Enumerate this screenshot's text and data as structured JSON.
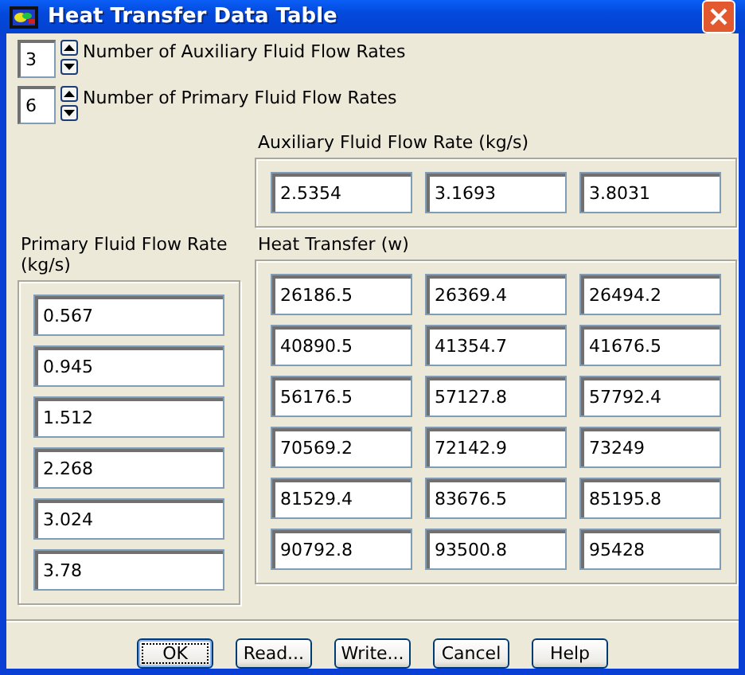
{
  "window": {
    "title": "Heat Transfer Data Table"
  },
  "counts": [
    {
      "value": "3",
      "label": "Number of Auxiliary Fluid Flow Rates"
    },
    {
      "value": "6",
      "label": "Number of Primary Fluid Flow Rates"
    }
  ],
  "auxiliary": {
    "label": "Auxiliary Fluid Flow Rate (kg/s)",
    "values": [
      "2.5354",
      "3.1693",
      "3.8031"
    ]
  },
  "primary": {
    "label": "Primary Fluid Flow Rate (kg/s)",
    "values": [
      "0.567",
      "0.945",
      "1.512",
      "2.268",
      "3.024",
      "3.78"
    ]
  },
  "heat_transfer": {
    "label": "Heat Transfer (w)",
    "rows": [
      [
        "26186.5",
        "26369.4",
        "26494.2"
      ],
      [
        "40890.5",
        "41354.7",
        "41676.5"
      ],
      [
        "56176.5",
        "57127.8",
        "57792.4"
      ],
      [
        "70569.2",
        "72142.9",
        "73249"
      ],
      [
        "81529.4",
        "83676.5",
        "85195.8"
      ],
      [
        "90792.8",
        "93500.8",
        "95428"
      ]
    ]
  },
  "buttons": [
    {
      "label": "OK",
      "focused": true
    },
    {
      "label": "Read...",
      "focused": false
    },
    {
      "label": "Write...",
      "focused": false
    },
    {
      "label": "Cancel",
      "focused": false
    },
    {
      "label": "Help",
      "focused": false
    }
  ]
}
